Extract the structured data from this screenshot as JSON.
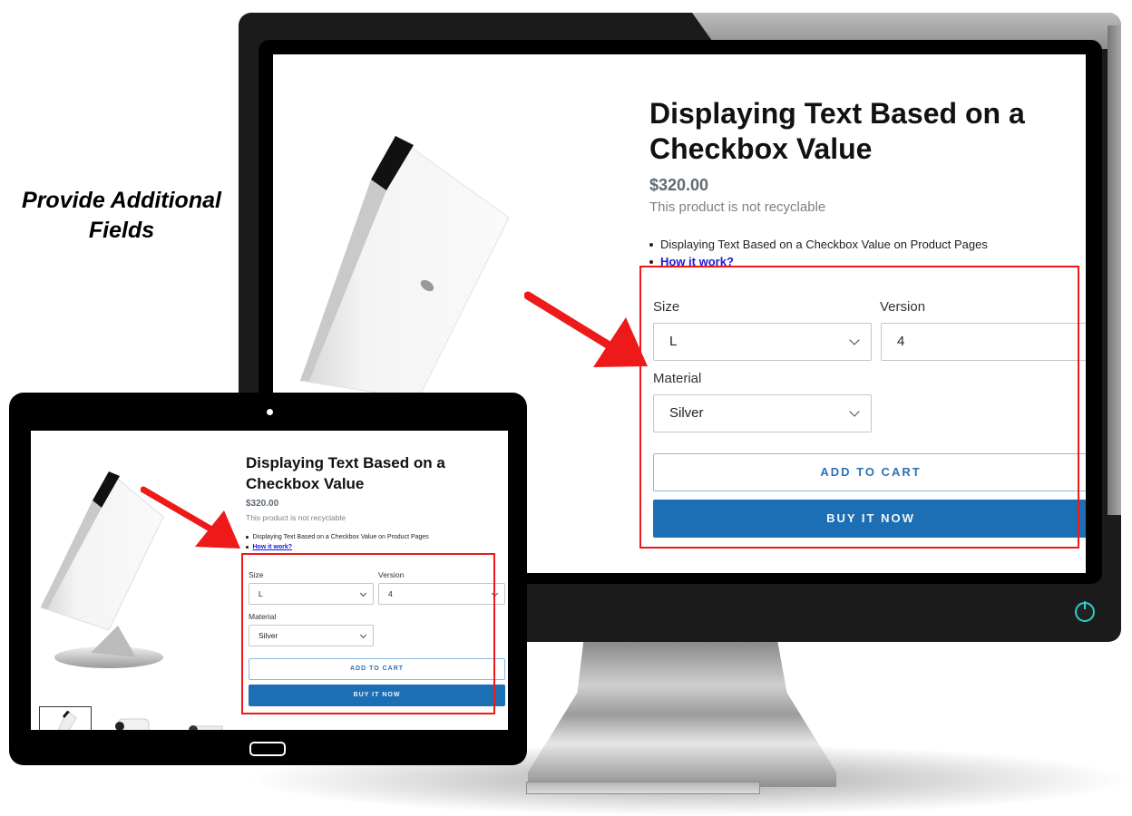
{
  "caption": {
    "line1": "Provide Additional",
    "line2": "Fields"
  },
  "product": {
    "title": "Displaying Text Based on a Checkbox Value",
    "price": "$320.00",
    "note": "This product is not recyclable",
    "bullets": [
      {
        "text": "Displaying Text Based on a Checkbox Value on Product Pages",
        "is_link": false
      },
      {
        "text": "How it work?",
        "is_link": true
      }
    ],
    "options": {
      "size": {
        "label": "Size",
        "value": "L"
      },
      "version": {
        "label": "Version",
        "value": "4"
      },
      "material": {
        "label": "Material",
        "value": "Silver"
      }
    },
    "add_to_cart_label": "ADD TO CART",
    "buy_now_label": "BUY IT NOW"
  },
  "colors": {
    "accent": "#1c6fb5",
    "highlight": "#ee1a1a",
    "power_led": "#2ad0c8"
  },
  "icons": {
    "arrow": "red-arrow-icon",
    "chevron": "chevron-down-icon",
    "power": "power-icon",
    "home": "home-button-icon",
    "camera": "camera-icon"
  }
}
